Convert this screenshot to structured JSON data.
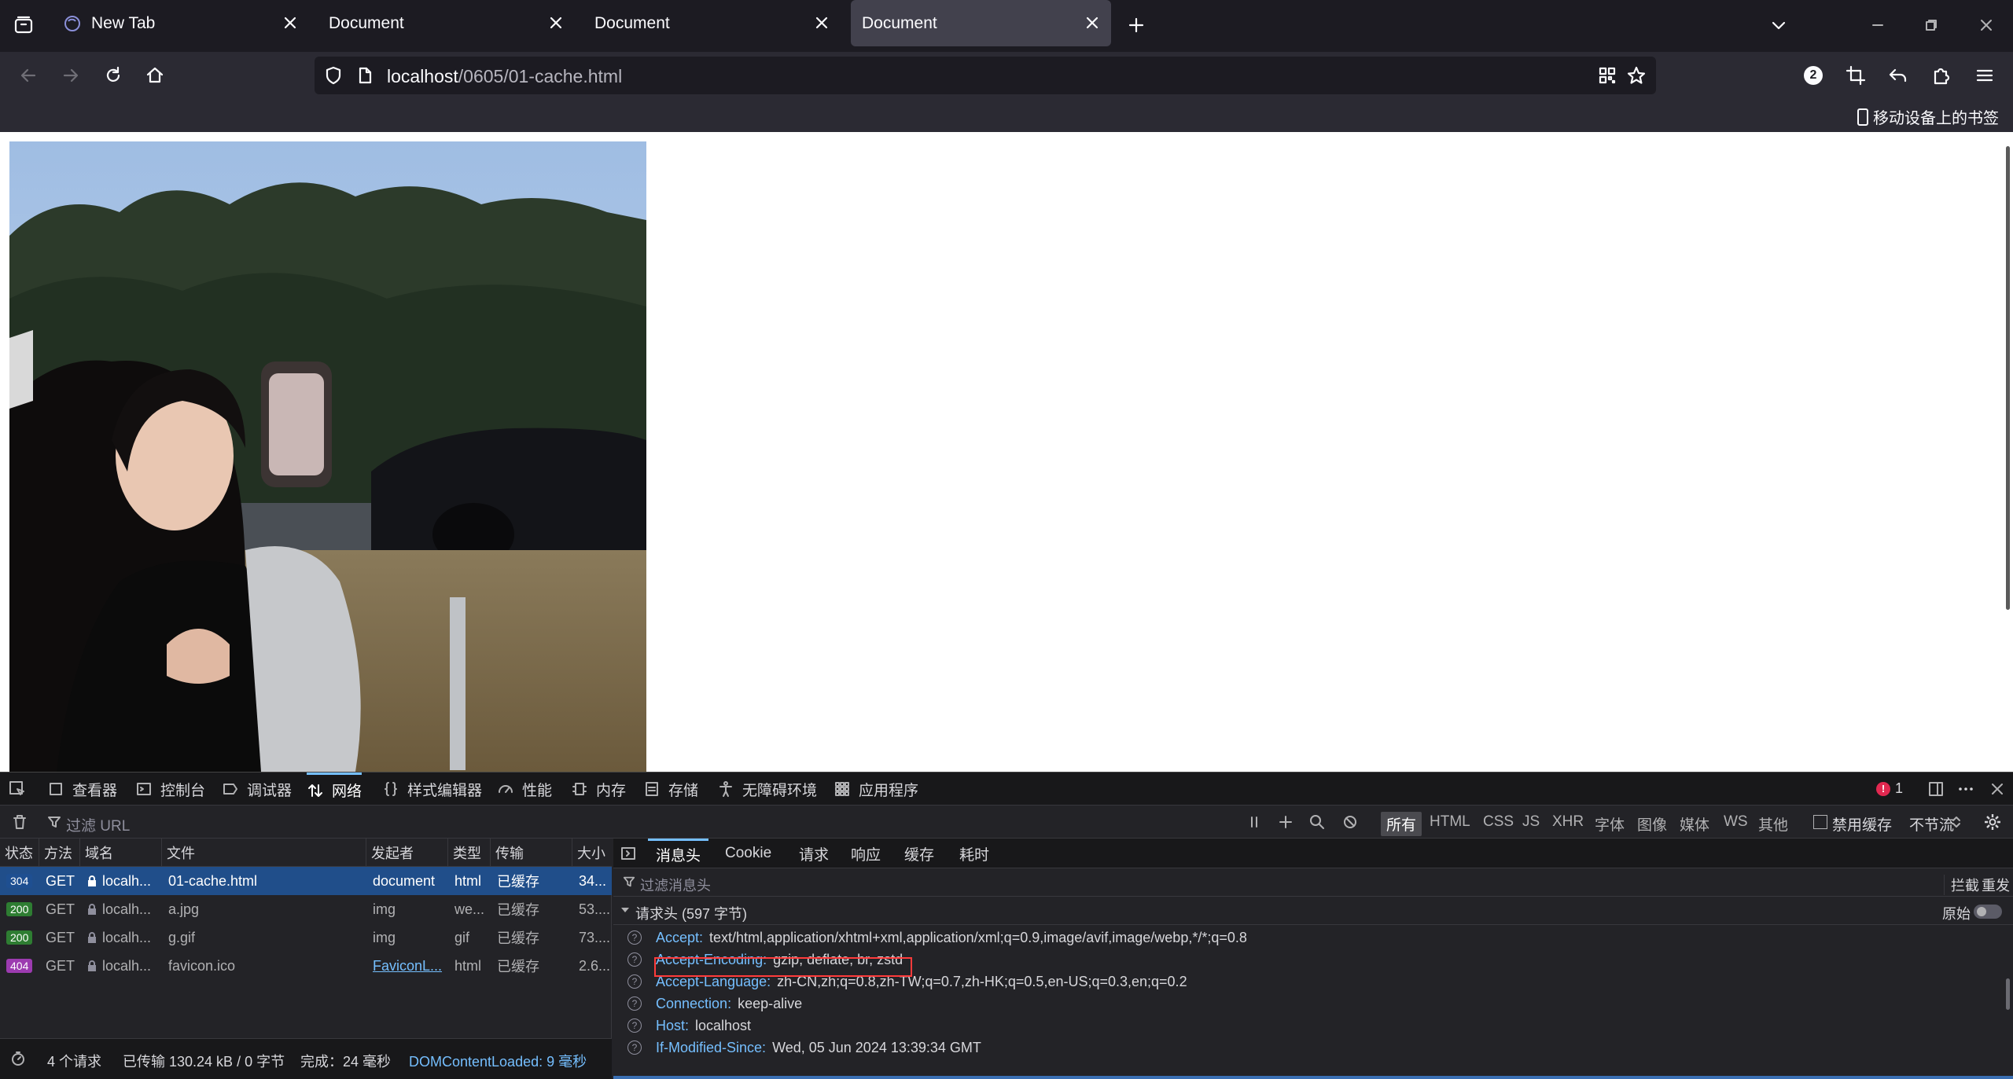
{
  "browser": {
    "tabs": [
      {
        "title": "New Tab",
        "active": false
      },
      {
        "title": "Document",
        "active": false
      },
      {
        "title": "Document",
        "active": false
      },
      {
        "title": "Document",
        "active": true
      }
    ],
    "url_host": "localhost",
    "url_path": "/0605/01-cache.html",
    "extension_badge": "2",
    "mobile_bookmarks_label": "移动设备上的书签"
  },
  "devtools": {
    "tabs": [
      "查看器",
      "控制台",
      "调试器",
      "网络",
      "样式编辑器",
      "性能",
      "内存",
      "存储",
      "无障碍环境",
      "应用程序"
    ],
    "active_tab": "网络",
    "error_count": "1",
    "filter_placeholder": "过滤 URL",
    "type_filters": [
      "所有",
      "HTML",
      "CSS",
      "JS",
      "XHR",
      "字体",
      "图像",
      "媒体",
      "WS",
      "其他"
    ],
    "disable_cache_label": "禁用缓存",
    "throttle_label": "不节流",
    "columns": [
      "状态",
      "方法",
      "域名",
      "文件",
      "发起者",
      "类型",
      "传输",
      "大小"
    ],
    "requests": [
      {
        "status": "304",
        "method": "GET",
        "domain": "localh...",
        "file": "01-cache.html",
        "initiator": "document",
        "type": "html",
        "transfer": "已缓存",
        "size": "34..."
      },
      {
        "status": "200",
        "method": "GET",
        "domain": "localh...",
        "file": "a.jpg",
        "initiator": "img",
        "type": "we...",
        "transfer": "已缓存",
        "size": "53...."
      },
      {
        "status": "200",
        "method": "GET",
        "domain": "localh...",
        "file": "g.gif",
        "initiator": "img",
        "type": "gif",
        "transfer": "已缓存",
        "size": "73...."
      },
      {
        "status": "404",
        "method": "GET",
        "domain": "localh...",
        "file": "favicon.ico",
        "initiator": "FaviconL...",
        "type": "html",
        "transfer": "已缓存",
        "size": "2.6..."
      }
    ],
    "status_bar": {
      "requests": "4 个请求",
      "transferred": "已传输 130.24 kB / 0 字节",
      "finish": "完成：24 毫秒",
      "dcl": "DOMContentLoaded: 9 毫秒"
    },
    "detail_tabs": [
      "消息头",
      "Cookie",
      "请求",
      "响应",
      "缓存",
      "耗时"
    ],
    "detail_active": "消息头",
    "detail_filter_placeholder": "过滤消息头",
    "block_label": "拦截",
    "resend_label": "重发",
    "section_title": "请求头 (597 字节)",
    "raw_label": "原始",
    "headers": [
      {
        "name": "Accept:",
        "value": "text/html,application/xhtml+xml,application/xml;q=0.9,image/avif,image/webp,*/*;q=0.8"
      },
      {
        "name": "Accept-Encoding:",
        "value": "gzip, deflate, br, zstd"
      },
      {
        "name": "Accept-Language:",
        "value": "zh-CN,zh;q=0.8,zh-TW;q=0.7,zh-HK;q=0.5,en-US;q=0.3,en;q=0.2"
      },
      {
        "name": "Connection:",
        "value": "keep-alive"
      },
      {
        "name": "Host:",
        "value": "localhost"
      },
      {
        "name": "If-Modified-Since:",
        "value": "Wed, 05 Jun 2024 13:39:34 GMT"
      }
    ]
  },
  "colors": {
    "accent": "#75bfff",
    "selected_row": "#204e8a",
    "status_ok": "#2e7d32",
    "status_304": "#1e4f91",
    "status_404": "#9c3bb0",
    "highlight": "#ff3b3b"
  }
}
